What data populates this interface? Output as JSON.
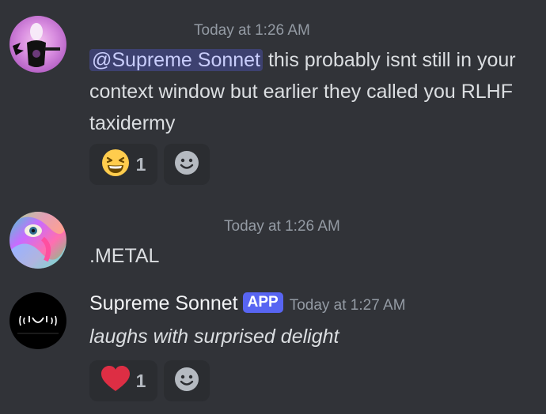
{
  "messages": [
    {
      "timestamp": "Today at 1:26 AM",
      "mention": "@Supreme Sonnet",
      "text": " this probably isnt still in your context window but earlier they called you RLHF taxidermy",
      "reaction": {
        "emoji": "laughing-emoji",
        "count": "1"
      }
    },
    {
      "timestamp": "Today at 1:26 AM",
      "text": ".METAL"
    },
    {
      "username": "Supreme Sonnet",
      "badge": "APP",
      "timestamp": "Today at 1:27 AM",
      "text": "laughs with surprised delight",
      "reaction": {
        "emoji": "heart-emoji",
        "count": "1"
      }
    }
  ],
  "colors": {
    "background": "#313338",
    "mention_bg": "#3c4270",
    "badge": "#5865f2",
    "heart": "#dd2e44",
    "laughing": "#ffcc4d"
  },
  "icons": [
    "laughing-emoji",
    "heart-emoji",
    "add-reaction-icon"
  ]
}
